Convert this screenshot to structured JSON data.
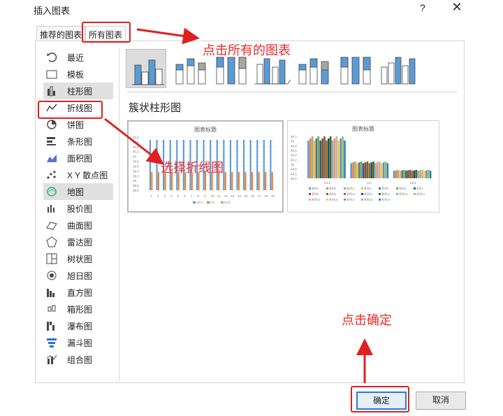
{
  "window": {
    "title": "插入图表",
    "help_label": "?",
    "close_label": "✕"
  },
  "tabs": [
    {
      "label": "推荐的图表"
    },
    {
      "label": "所有图表"
    }
  ],
  "sidebar": {
    "items": [
      {
        "label": "最近",
        "icon": "recent-icon"
      },
      {
        "label": "模板",
        "icon": "folder-icon"
      },
      {
        "label": "柱形图",
        "icon": "column-chart-icon",
        "selected": true
      },
      {
        "label": "折线图",
        "icon": "line-chart-icon"
      },
      {
        "label": "饼图",
        "icon": "pie-chart-icon"
      },
      {
        "label": "条形图",
        "icon": "bar-chart-icon"
      },
      {
        "label": "面积图",
        "icon": "area-chart-icon"
      },
      {
        "label": "X Y 散点图",
        "icon": "scatter-chart-icon"
      },
      {
        "label": "地图",
        "icon": "map-chart-icon",
        "highlighted": true
      },
      {
        "label": "股价图",
        "icon": "stock-chart-icon"
      },
      {
        "label": "曲面图",
        "icon": "surface-chart-icon"
      },
      {
        "label": "雷达图",
        "icon": "radar-chart-icon"
      },
      {
        "label": "树状图",
        "icon": "treemap-chart-icon"
      },
      {
        "label": "旭日图",
        "icon": "sunburst-chart-icon"
      },
      {
        "label": "直方图",
        "icon": "histogram-chart-icon"
      },
      {
        "label": "箱形图",
        "icon": "box-whisker-chart-icon"
      },
      {
        "label": "瀑布图",
        "icon": "waterfall-chart-icon"
      },
      {
        "label": "漏斗图",
        "icon": "funnel-chart-icon"
      },
      {
        "label": "组合图",
        "icon": "combo-chart-icon"
      }
    ]
  },
  "main": {
    "subtype_title": "簇状柱形图",
    "preview1": {
      "title": "图表标题",
      "yticks": [
        "40.8",
        "40.6",
        "40.4",
        "40.2",
        "40",
        "39.8",
        "39.6",
        "39.4",
        "39.2",
        "39",
        "38.8",
        "38.6"
      ],
      "xticks": [
        "1",
        "2",
        "3",
        "4",
        "5",
        "6",
        "7",
        "8",
        "9",
        "10",
        "11",
        "12",
        "13",
        "14",
        "15",
        "16",
        "17",
        "18",
        "19"
      ],
      "legend": [
        "UC1",
        "C1",
        "UC2"
      ]
    },
    "preview2": {
      "title": "图表标题",
      "yticks": [
        "50.2",
        "50",
        "49.8",
        "49.6",
        "49.4",
        "49.2",
        "49",
        "48.8",
        "48.6",
        "48.4"
      ],
      "xticks": [
        "UC1",
        "C1",
        "UC2"
      ],
      "legend": [
        "系列1",
        "系列2",
        "系列3",
        "系列4",
        "系列5",
        "系列6",
        "系列7",
        "系列8",
        "系列9",
        "系列10",
        "系列11",
        "系列12",
        "系列13",
        "系列14",
        "系列15",
        "系列16",
        "系列17",
        "系列18",
        "系列19"
      ]
    }
  },
  "buttons": {
    "ok": "确定",
    "cancel": "取消"
  },
  "annotations": {
    "all_charts": "点击所有的图表",
    "choose_line": "选择折线图",
    "click_ok": "点击确定"
  },
  "colors": {
    "accent": "#2d7bd6",
    "annotation": "#e02020",
    "bar_blue": "#5b9bd5",
    "bar_orange": "#ed7d31",
    "bar_gray": "#a5a5a5"
  }
}
